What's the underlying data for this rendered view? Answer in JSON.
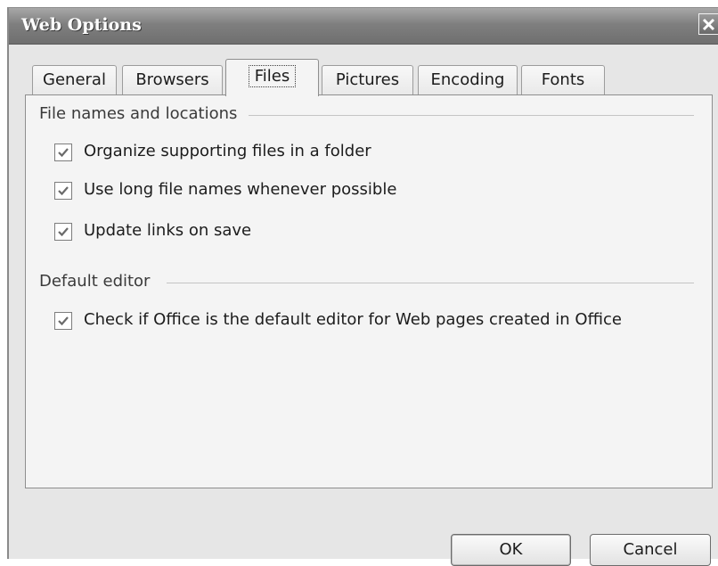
{
  "window": {
    "title": "Web Options"
  },
  "tabs": [
    {
      "label": "General",
      "active": false
    },
    {
      "label": "Browsers",
      "active": false
    },
    {
      "label": "Files",
      "active": true
    },
    {
      "label": "Pictures",
      "active": false
    },
    {
      "label": "Encoding",
      "active": false
    },
    {
      "label": "Fonts",
      "active": false
    }
  ],
  "file_names_group": {
    "label": "File names and locations",
    "options": [
      {
        "label": "Organize supporting files in a folder",
        "checked": true
      },
      {
        "label": "Use long file names whenever possible",
        "checked": true
      },
      {
        "label": "Update links on save",
        "checked": true
      }
    ]
  },
  "default_editor_group": {
    "label": "Default editor",
    "options": [
      {
        "label": "Check if Office is the default editor for Web pages created in Office",
        "checked": true
      }
    ]
  },
  "buttons": {
    "ok": "OK",
    "cancel": "Cancel"
  }
}
